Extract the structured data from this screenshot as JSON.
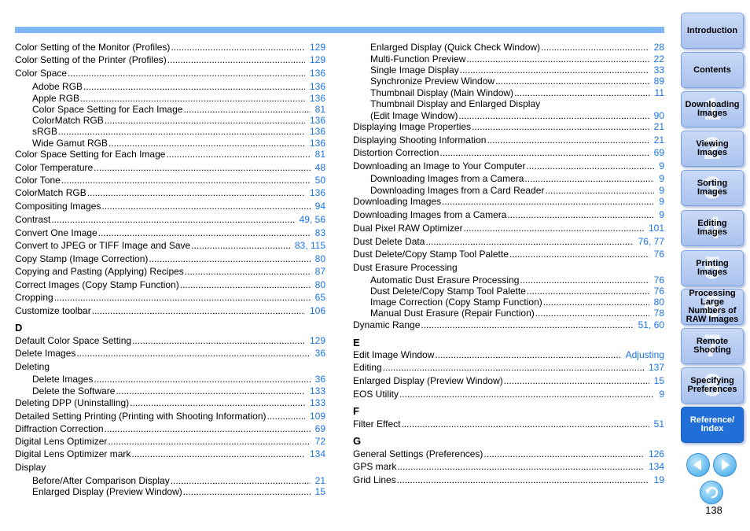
{
  "left_column": [
    {
      "type": "entry",
      "label": "Color Setting of the Monitor (Profiles)",
      "page": "129"
    },
    {
      "type": "entry",
      "label": "Color Setting of the Printer (Profiles)",
      "page": "129"
    },
    {
      "type": "entry",
      "label": "Color Space",
      "page": "136"
    },
    {
      "type": "sub",
      "label": "Adobe RGB",
      "page": "136"
    },
    {
      "type": "sub",
      "label": "Apple RGB",
      "page": "136"
    },
    {
      "type": "sub",
      "label": "Color Space Setting for Each Image",
      "page": "81"
    },
    {
      "type": "sub",
      "label": "ColorMatch RGB",
      "page": "136"
    },
    {
      "type": "sub",
      "label": "sRGB",
      "page": "136"
    },
    {
      "type": "sub",
      "label": "Wide Gamut RGB",
      "page": "136"
    },
    {
      "type": "entry",
      "label": "Color Space Setting for Each Image",
      "page": "81"
    },
    {
      "type": "entry",
      "label": "Color Temperature",
      "page": "48"
    },
    {
      "type": "entry",
      "label": "Color Tone",
      "page": "50"
    },
    {
      "type": "entry",
      "label": "ColorMatch RGB",
      "page": "136"
    },
    {
      "type": "entry",
      "label": "Compositing Images",
      "page": "94"
    },
    {
      "type": "entry",
      "label": "Contrast",
      "page": "49, 56"
    },
    {
      "type": "entry",
      "label": "Convert One Image",
      "page": "83"
    },
    {
      "type": "entry",
      "label": "Convert to JPEG or TIFF Image and Save",
      "page": "83, 115"
    },
    {
      "type": "entry",
      "label": "Copy Stamp (Image Correction)",
      "page": "80"
    },
    {
      "type": "entry",
      "label": "Copying and Pasting (Applying) Recipes",
      "page": "87"
    },
    {
      "type": "entry",
      "label": "Correct Images (Copy Stamp Function)",
      "page": "80"
    },
    {
      "type": "entry",
      "label": "Cropping",
      "page": "65"
    },
    {
      "type": "entry",
      "label": "Customize toolbar",
      "page": "106"
    },
    {
      "type": "letter",
      "label": "D"
    },
    {
      "type": "entry",
      "label": "Default Color Space Setting",
      "page": "129"
    },
    {
      "type": "entry",
      "label": "Delete Images",
      "page": "36"
    },
    {
      "type": "head",
      "label": "Deleting"
    },
    {
      "type": "sub",
      "label": "Delete Images",
      "page": "36"
    },
    {
      "type": "sub",
      "label": "Delete the Software",
      "page": "133"
    },
    {
      "type": "entry",
      "label": "Deleting DPP (Uninstalling)",
      "page": "133"
    },
    {
      "type": "entry",
      "label": "Detailed Setting Printing (Printing with Shooting Information)",
      "page": "109"
    },
    {
      "type": "entry",
      "label": "Diffraction Correction",
      "page": "69"
    },
    {
      "type": "entry",
      "label": "Digital Lens Optimizer",
      "page": "72"
    },
    {
      "type": "entry",
      "label": "Digital Lens Optimizer mark",
      "page": "134"
    },
    {
      "type": "head",
      "label": "Display"
    },
    {
      "type": "sub",
      "label": "Before/After Comparison Display",
      "page": "21"
    },
    {
      "type": "sub",
      "label": "Enlarged Display (Preview Window)",
      "page": "15"
    }
  ],
  "right_column": [
    {
      "type": "sub",
      "label": "Enlarged Display (Quick Check Window)",
      "page": "28"
    },
    {
      "type": "sub",
      "label": "Multi-Function Preview",
      "page": "22"
    },
    {
      "type": "sub",
      "label": "Single Image Display",
      "page": "33"
    },
    {
      "type": "sub",
      "label": "Synchronize Preview Window",
      "page": "89"
    },
    {
      "type": "sub",
      "label": "Thumbnail Display (Main Window)",
      "page": "11"
    },
    {
      "type": "subhead",
      "label": "Thumbnail Display and Enlarged Display"
    },
    {
      "type": "sub",
      "label": "(Edit Image Window)",
      "page": "90"
    },
    {
      "type": "entry",
      "label": "Displaying Image Properties",
      "page": "21"
    },
    {
      "type": "entry",
      "label": "Displaying Shooting Information",
      "page": "21"
    },
    {
      "type": "entry",
      "label": "Distortion Correction",
      "page": "69"
    },
    {
      "type": "entry",
      "label": "Downloading an Image to Your Computer",
      "page": "9"
    },
    {
      "type": "sub",
      "label": "Downloading Images from a Camera",
      "page": "9"
    },
    {
      "type": "sub",
      "label": "Downloading Images from a Card Reader",
      "page": "9"
    },
    {
      "type": "entry",
      "label": "Downloading Images",
      "page": "9"
    },
    {
      "type": "entry",
      "label": "Downloading Images from a Camera",
      "page": "9"
    },
    {
      "type": "entry",
      "label": "Dual Pixel RAW Optimizer",
      "page": "101"
    },
    {
      "type": "entry",
      "label": "Dust Delete Data",
      "page": "76, 77"
    },
    {
      "type": "entry",
      "label": "Dust Delete/Copy Stamp Tool Palette",
      "page": "76"
    },
    {
      "type": "head",
      "label": "Dust Erasure Processing"
    },
    {
      "type": "sub",
      "label": "Automatic Dust Erasure Processing",
      "page": "76"
    },
    {
      "type": "sub",
      "label": "Dust Delete/Copy Stamp Tool Palette",
      "page": "76"
    },
    {
      "type": "sub",
      "label": "Image Correction (Copy Stamp Function)",
      "page": "80"
    },
    {
      "type": "sub",
      "label": "Manual Dust Erasure (Repair Function)",
      "page": "78"
    },
    {
      "type": "entry",
      "label": "Dynamic Range",
      "page": "51, 60"
    },
    {
      "type": "letter",
      "label": "E"
    },
    {
      "type": "entry",
      "label": "Edit Image Window",
      "page": "Adjusting"
    },
    {
      "type": "entry",
      "label": "Editing",
      "page": "137"
    },
    {
      "type": "entry",
      "label": "Enlarged Display (Preview Window)",
      "page": "15"
    },
    {
      "type": "entry",
      "label": "EOS Utility",
      "page": "9"
    },
    {
      "type": "letter",
      "label": "F"
    },
    {
      "type": "entry",
      "label": "Filter Effect",
      "page": "51"
    },
    {
      "type": "letter",
      "label": "G"
    },
    {
      "type": "entry",
      "label": "General Settings (Preferences)",
      "page": "126"
    },
    {
      "type": "entry",
      "label": "GPS mark",
      "page": "134"
    },
    {
      "type": "entry",
      "label": "Grid Lines",
      "page": "19"
    }
  ],
  "tabs": [
    {
      "label": "Introduction",
      "num": ""
    },
    {
      "label": "Contents",
      "num": ""
    },
    {
      "label": "Downloading Images",
      "num": "1"
    },
    {
      "label": "Viewing Images",
      "num": "2"
    },
    {
      "label": "Sorting Images",
      "num": "3"
    },
    {
      "label": "Editing Images",
      "num": "4"
    },
    {
      "label": "Printing Images",
      "num": "5"
    },
    {
      "label": "Processing Large Numbers of RAW Images",
      "num": "6"
    },
    {
      "label": "Remote Shooting",
      "num": "7"
    },
    {
      "label": "Specifying Preferences",
      "num": "8"
    },
    {
      "label": "Reference/ Index",
      "num": "",
      "active": true
    }
  ],
  "nav": {
    "prev_icon": "left-arrow-icon",
    "next_icon": "right-arrow-icon",
    "back_icon": "return-icon"
  },
  "page_number": "138",
  "colors": {
    "accent": "#1a73e8",
    "topbar": "#7fb7f5",
    "active_tab": "#1f6fd6",
    "tab": "#b5cbf1"
  }
}
